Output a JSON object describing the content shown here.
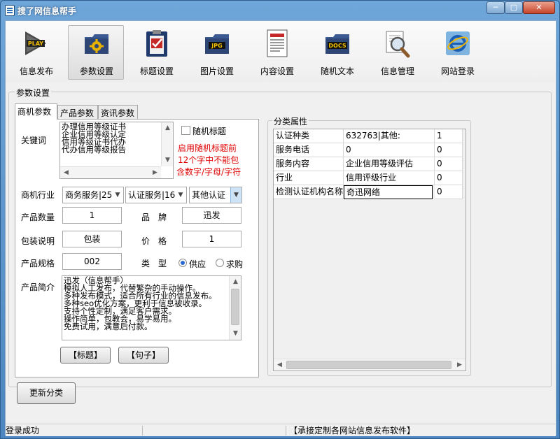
{
  "window": {
    "title": "搜了网信息帮手",
    "min": "─",
    "max": "▢",
    "close": "✕"
  },
  "toolbar": [
    {
      "label": "信息发布",
      "icon": "play-icon",
      "selected": false
    },
    {
      "label": "参数设置",
      "icon": "gear-folder-icon",
      "selected": true
    },
    {
      "label": "标题设置",
      "icon": "clipboard-check-icon",
      "selected": false
    },
    {
      "label": "图片设置",
      "icon": "jpg-folder-icon",
      "selected": false
    },
    {
      "label": "内容设置",
      "icon": "document-icon",
      "selected": false
    },
    {
      "label": "随机文本",
      "icon": "docs-folder-icon",
      "selected": false
    },
    {
      "label": "信息管理",
      "icon": "magnifier-icon",
      "selected": false
    },
    {
      "label": "网站登录",
      "icon": "ie-icon",
      "selected": false
    }
  ],
  "params": {
    "group_title": "参数设置",
    "tabs": [
      {
        "label": "商机参数",
        "selected": true
      },
      {
        "label": "产品参数",
        "selected": false
      },
      {
        "label": "资讯参数",
        "selected": false
      }
    ],
    "keywords_label": "关键词",
    "keywords": [
      "办理信用等级证书",
      "企业信用等级认定",
      "信用等级证书代办",
      "代办信用等级报告"
    ],
    "random_title_label": "随机标题",
    "random_title_checked": false,
    "warning": [
      "启用随机标题前",
      "12个字中不能包",
      "含数字/字母/字符"
    ],
    "industry_label": "商机行业",
    "industry_selects": [
      "商务服务|25",
      "认证服务|16",
      "其他认证"
    ],
    "product_count_label": "产品数量",
    "product_count": "1",
    "brand_label": "品　牌",
    "brand": "迅发",
    "package_label": "包装说明",
    "package": "包装",
    "price_label": "价　格",
    "price": "1",
    "spec_label": "产品规格",
    "spec": "002",
    "type_label": "类　型",
    "type_supply": "供应",
    "type_purchase": "求购",
    "type_selected": "供应",
    "intro_label": "产品简介",
    "intro": [
      "迅发（信息帮手）",
      "模拟人工发布，代替繁杂的手动操作。",
      "多种发布模式，适合所有行业的信息发布。",
      "多种seo优化方案，更利于信息被收录。",
      "支持个性定制，满足客户需求。",
      "操作简单，包教会，易学易用。",
      "免费试用，满意后付款。"
    ],
    "title_btn": "【标题】",
    "sentence_btn": "【句子】"
  },
  "classification": {
    "group_title": "分类属性",
    "rows": [
      [
        "认证种类",
        "632763|其他:",
        "1"
      ],
      [
        "服务电话",
        "0",
        "0"
      ],
      [
        "服务内容",
        "企业信用等级评估",
        "0"
      ],
      [
        "行业",
        "信用评级行业",
        "0"
      ],
      [
        "检测认证机构名称",
        "奇迅网络",
        "0"
      ]
    ]
  },
  "update_btn": "更新分类",
  "status": {
    "left": "登录成功",
    "right": "【承接定制各网站信息发布软件】"
  }
}
